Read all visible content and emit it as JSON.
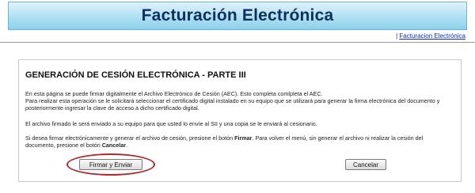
{
  "header": {
    "title": "Facturación Electrónica"
  },
  "nav": {
    "separator": "|",
    "link_label": "Facturacion Electrónica"
  },
  "main": {
    "heading": "GENERACIÓN DE CESIÓN ELECTRÓNICA - PARTE III",
    "para1_line1": "En esta página se puede firmar digitalmente el Archivo Electrónico de Cesión (AEC). Esto completa comlpleta el AEC.",
    "para1_line2": "Para realizar esta operación se le solicitará seleccionar el certificado digital instalado en su equipo que se utilizará para generar la firma electrónica del documento y posteriormente ingresar la clave de acceso a dicho certificado digital.",
    "para2": "El archivo firmado le será enviado a su equipo para que usted lo envíe al SII y una copia se le enviará al cesionario.",
    "para3_a": "Si desea firmar electrónicamente y generar el archivo de cesión, presione el botón ",
    "para3_firmar": "Firmar",
    "para3_b": ". Para volver el menú, sin generar el archivo ni realizar la cesión del documento, presione el botón ",
    "para3_cancelar": "Cancelar",
    "para3_c": "."
  },
  "buttons": {
    "firmar_label": "Firmar y Enviar",
    "cancelar_label": "Cancelar"
  },
  "colors": {
    "banner": "#a9def2",
    "highlight_ring": "#b0282c",
    "link": "#0a2fae"
  }
}
